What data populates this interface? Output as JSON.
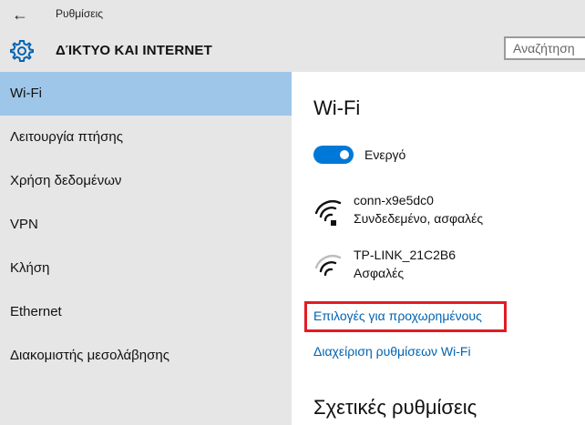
{
  "titlebar": {
    "back_icon": "back-arrow-icon",
    "app_title": "Ρυθμίσεις"
  },
  "header": {
    "icon": "gear-icon",
    "page_title": "ΔΊΚΤΥΟ ΚΑΙ INTERNET",
    "search_placeholder": "Αναζήτηση"
  },
  "sidebar": {
    "items": [
      {
        "label": "Wi-Fi",
        "selected": true
      },
      {
        "label": "Λειτουργία πτήσης"
      },
      {
        "label": "Χρήση δεδομένων"
      },
      {
        "label": "VPN"
      },
      {
        "label": "Κλήση"
      },
      {
        "label": "Ethernet"
      },
      {
        "label": "Διακομιστής μεσολάβησης"
      }
    ]
  },
  "main": {
    "heading": "Wi-Fi",
    "toggle": {
      "state_label": "Ενεργό",
      "on": true
    },
    "networks": [
      {
        "ssid": "conn-x9e5dc0",
        "status": "Συνδεδεμένο, ασφαλές",
        "connected": true
      },
      {
        "ssid": "TP-LINK_21C2B6",
        "status": "Ασφαλές",
        "connected": false
      }
    ],
    "advanced_link": "Επιλογές για προχωρημένους",
    "manage_link": "Διαχείριση ρυθμίσεων Wi-Fi",
    "related_heading": "Σχετικές ρυθμίσεις"
  },
  "colors": {
    "accent": "#0078d7",
    "link": "#0063b1",
    "sidebar_bg": "#e6e6e6",
    "selected_bg": "#9ec6e8",
    "highlight": "#e21b23"
  }
}
